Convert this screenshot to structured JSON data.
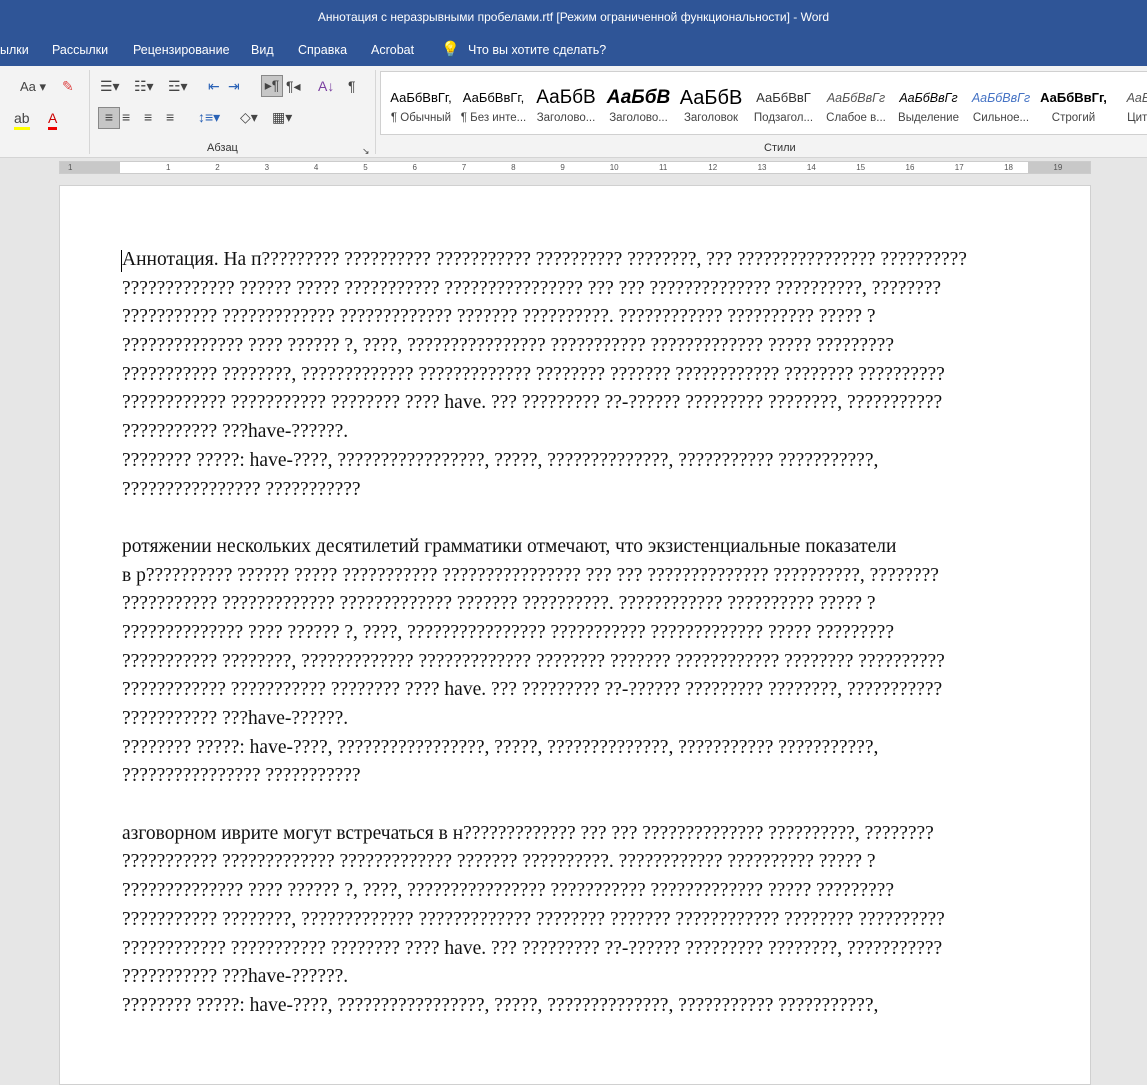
{
  "window": {
    "title": "Аннотация с неразрывными пробелами.rtf [Режим ограниченной функциональности]  -  Word"
  },
  "tabs": [
    "ылки",
    "Рассылки",
    "Рецензирование",
    "Вид",
    "Справка",
    "Acrobat"
  ],
  "tell_me": "Что вы хотите сделать?",
  "ribbon": {
    "font_case": "Aa",
    "paragraph_group": "Абзац",
    "styles_group": "Стили",
    "styles": [
      {
        "preview": "АаБбВвГг,",
        "name": "¶ Обычный"
      },
      {
        "preview": "АаБбВвГг,",
        "name": "¶ Без инте..."
      },
      {
        "preview": "АаБбВ",
        "name": "Заголово..."
      },
      {
        "preview": "АаБбВ",
        "name": "Заголово..."
      },
      {
        "preview": "АаБбВ",
        "name": "Заголовок"
      },
      {
        "preview": "АаБбВвГ",
        "name": "Подзагол..."
      },
      {
        "preview": "АаБбВвГг",
        "name": "Слабое в..."
      },
      {
        "preview": "АаБбВвГг",
        "name": "Выделение"
      },
      {
        "preview": "АаБбВвГг",
        "name": "Сильное..."
      },
      {
        "preview": "АаБбВвГг,",
        "name": "Строгий"
      },
      {
        "preview": "АаБбВ",
        "name": "Цитата"
      }
    ]
  },
  "ruler": {
    "labels": [
      "1",
      "1",
      "2",
      "3",
      "4",
      "5",
      "6",
      "7",
      "8",
      "9",
      "10",
      "11",
      "12",
      "13",
      "14",
      "15",
      "16",
      "17",
      "18",
      "19"
    ]
  },
  "document": {
    "lines": [
      "Аннотация. На п????????? ?????????? ??????????? ?????????? ????????, ??? ???????????????? ??????????",
      "????????????? ?????? ????? ??????????? ???????????????? ??? ??? ?????????????? ??????????, ????????",
      "??????????? ????????????? ????????????? ??????? ??????????. ???????????? ?????????? ????? ?",
      "?????????????? ???? ?????? ?, ????, ???????????????? ??????????? ????????????? ????? ?????????",
      "??????????? ????????, ????????????? ????????????? ???????? ??????? ???????????? ???????? ??????????",
      "???????????? ??????????? ???????? ???? have. ??? ????????? ??-?????? ????????? ????????, ???????????",
      "??????????? ???have-??????.",
      "???????? ?????: have-????, ?????????????????, ?????, ??????????????, ??????????? ???????????,",
      "???????????????? ???????????",
      "",
      "ротяжении нескольких десятилетий грамматики отмечают, что экзистенциальные показатели",
      "в р?????????? ?????? ????? ??????????? ???????????????? ??? ??? ?????????????? ??????????, ????????",
      "??????????? ????????????? ????????????? ??????? ??????????. ???????????? ?????????? ????? ?",
      "?????????????? ???? ?????? ?, ????, ???????????????? ??????????? ????????????? ????? ?????????",
      "??????????? ????????, ????????????? ????????????? ???????? ??????? ???????????? ???????? ??????????",
      "???????????? ??????????? ???????? ???? have. ??? ????????? ??-?????? ????????? ????????, ???????????",
      "??????????? ???have-??????.",
      "???????? ?????: have-????, ?????????????????, ?????, ??????????????, ??????????? ???????????,",
      "???????????????? ???????????",
      "",
      "азговорном иврите могут встречаться в н????????????? ??? ??? ?????????????? ??????????, ????????",
      "??????????? ????????????? ????????????? ??????? ??????????. ???????????? ?????????? ????? ?",
      "?????????????? ???? ?????? ?, ????, ???????????????? ??????????? ????????????? ????? ?????????",
      "??????????? ????????, ????????????? ????????????? ???????? ??????? ???????????? ???????? ??????????",
      "???????????? ??????????? ???????? ???? have. ??? ????????? ??-?????? ????????? ????????, ???????????",
      "??????????? ???have-??????.",
      "???????? ?????: have-????, ?????????????????, ?????, ??????????????, ??????????? ???????????,"
    ]
  }
}
